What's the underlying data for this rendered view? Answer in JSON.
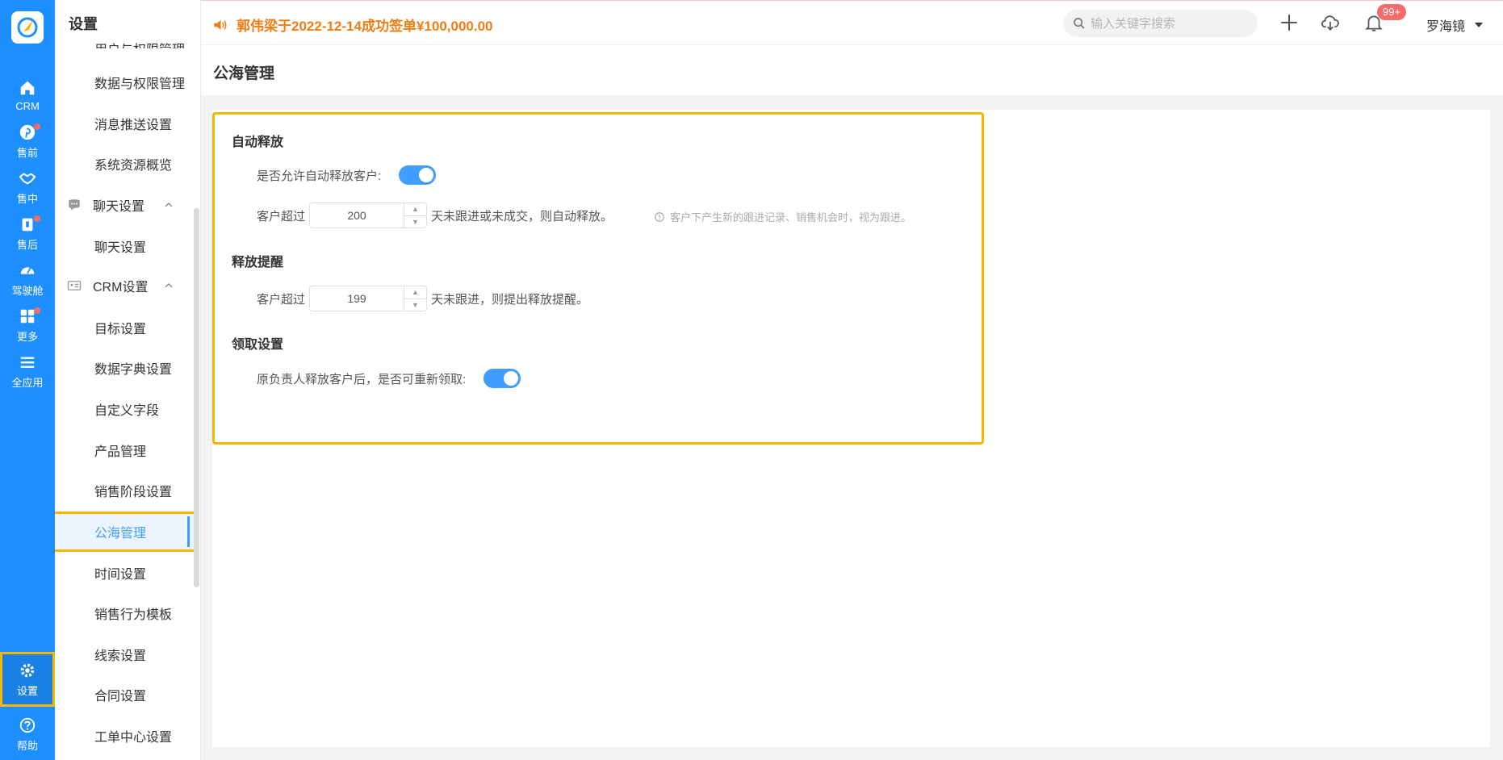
{
  "rail": {
    "items": [
      {
        "label": "CRM",
        "icon": "home-icon"
      },
      {
        "label": "售前",
        "icon": "pinterest-icon",
        "dot": true
      },
      {
        "label": "售中",
        "icon": "handshake-icon"
      },
      {
        "label": "售后",
        "icon": "clipboard-icon",
        "dot": true
      },
      {
        "label": "驾驶舱",
        "icon": "dashboard-icon"
      },
      {
        "label": "更多",
        "icon": "grid-icon",
        "dot": true
      },
      {
        "label": "全应用",
        "icon": "menu-icon"
      },
      {
        "label": "设置",
        "icon": "gear-icon"
      },
      {
        "label": "帮助",
        "icon": "help-icon"
      }
    ]
  },
  "sidebar": {
    "title": "设置",
    "partial_item": "用户与权限管理",
    "items": [
      "数据与权限管理",
      "消息推送设置",
      "系统资源概览"
    ],
    "group_chat": "聊天设置",
    "chat_items": [
      "聊天设置"
    ],
    "group_crm": "CRM设置",
    "crm_items": [
      "目标设置",
      "数据字典设置",
      "自定义字段",
      "产品管理",
      "销售阶段设置",
      "公海管理",
      "时间设置",
      "销售行为模板",
      "线索设置",
      "合同设置",
      "工单中心设置"
    ]
  },
  "topbar": {
    "announcement": "郭伟梁于2022-12-14成功签单¥100,000.00",
    "search_placeholder": "输入关键字搜索",
    "badge": "99+",
    "user": "罗海镜"
  },
  "page": {
    "title": "公海管理"
  },
  "settings": {
    "auto_release": {
      "title": "自动释放",
      "allow_label": "是否允许自动释放客户:",
      "allow_on": true,
      "prefix": "客户超过",
      "days": "200",
      "suffix": "天未跟进或未成交，则自动释放。",
      "hint": "客户下产生新的跟进记录、销售机会时，视为跟进。"
    },
    "release_reminder": {
      "title": "释放提醒",
      "prefix": "客户超过",
      "days": "199",
      "suffix": "天未跟进，则提出释放提醒。"
    },
    "claim": {
      "title": "领取设置",
      "label": "原负责人释放客户后，是否可重新领取:",
      "on": true
    }
  },
  "colors": {
    "rail_bg": "#1e8fff",
    "accent": "#409eff",
    "highlight": "#f5b800",
    "announce": "#f07d14",
    "badge": "#f56c6c"
  }
}
